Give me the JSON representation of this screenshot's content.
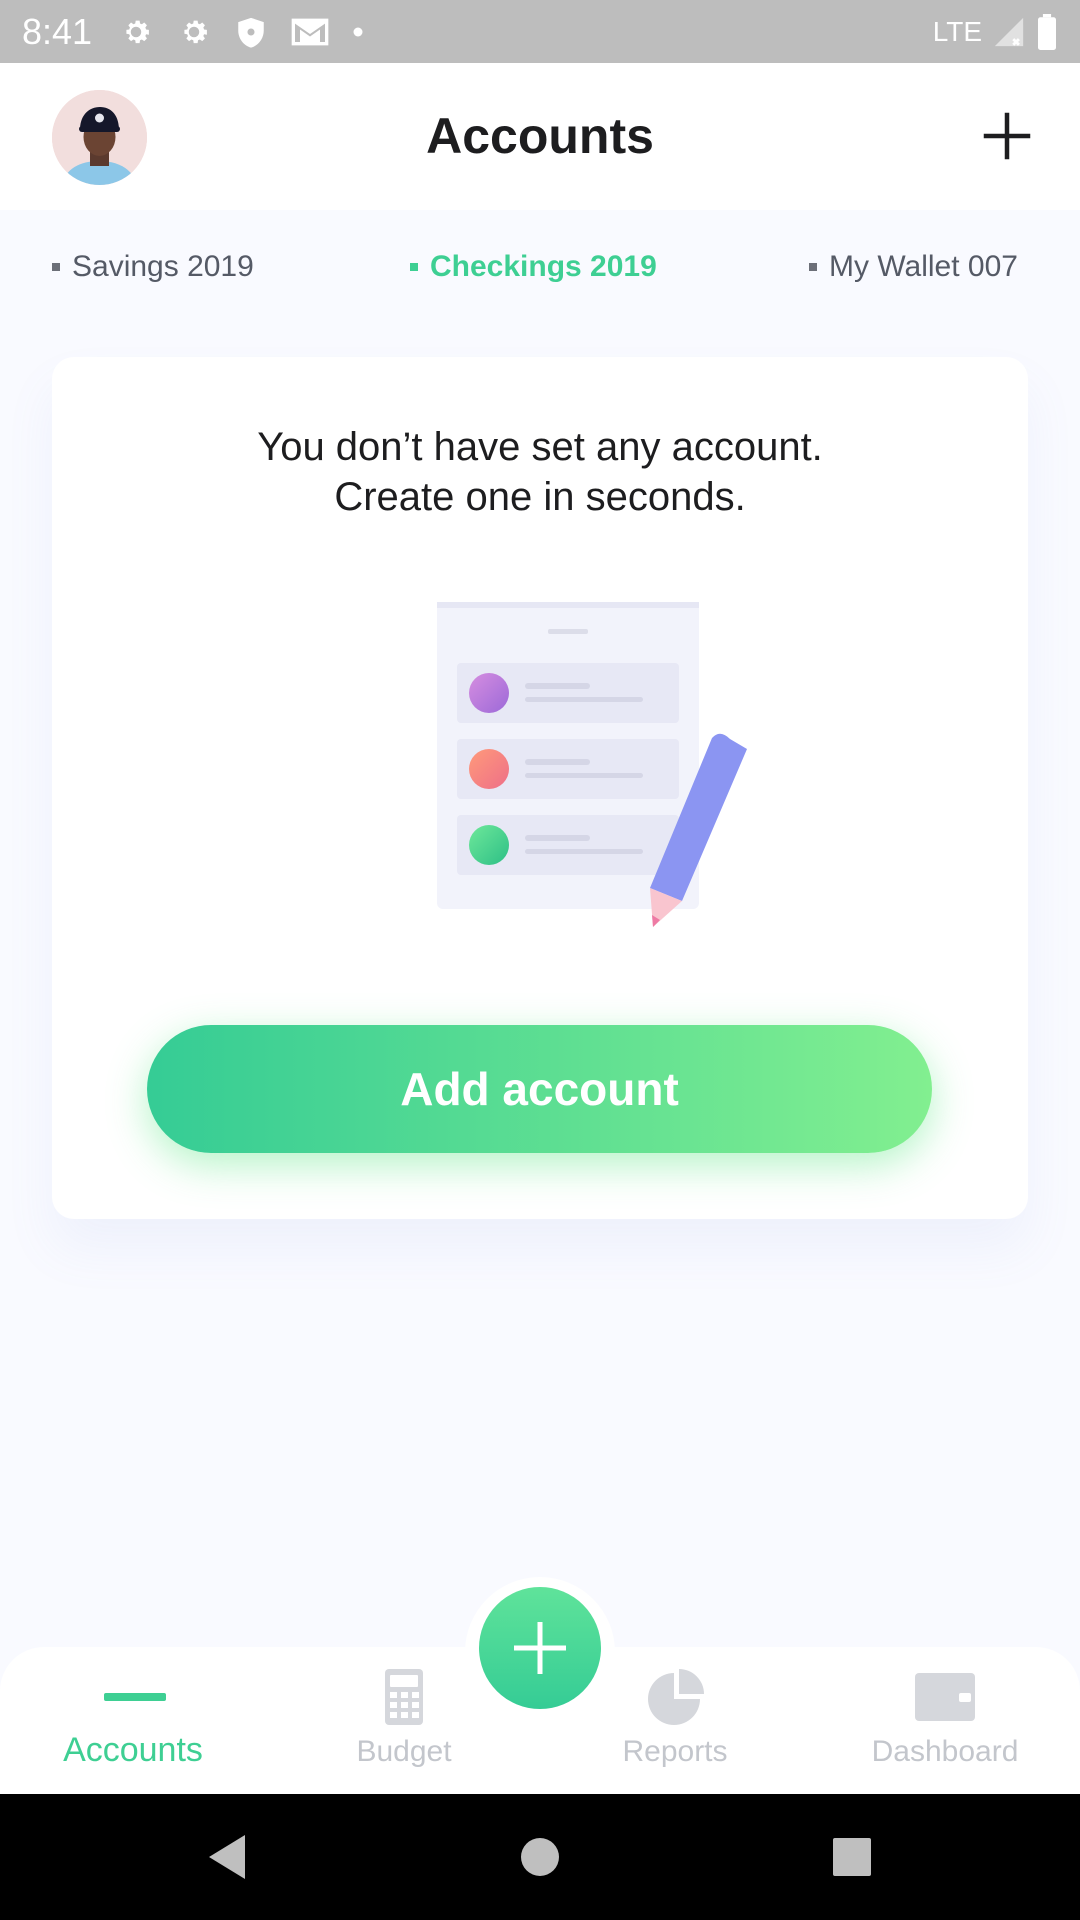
{
  "status_bar": {
    "time": "8:41",
    "network": "LTE",
    "icons": [
      "settings-icon",
      "settings-icon",
      "shield-icon",
      "gmail-icon",
      "dot-icon",
      "signal-icon",
      "battery-icon"
    ]
  },
  "header": {
    "title": "Accounts",
    "avatar": "avatar",
    "add_icon": "plus-icon"
  },
  "tabs": [
    {
      "label": "Savings 2019",
      "active": false
    },
    {
      "label": "Checkings 2019",
      "active": true
    },
    {
      "label": "My Wallet 007",
      "active": false
    }
  ],
  "empty_state": {
    "message_line1": "You don’t have set any account.",
    "message_line2": "Create one in seconds.",
    "button_label": "Add account"
  },
  "bottom_nav": {
    "items": [
      {
        "label": "Accounts",
        "icon": "accounts-indicator",
        "active": true
      },
      {
        "label": "Budget",
        "icon": "calculator-icon",
        "active": false
      },
      {
        "label": "Reports",
        "icon": "pie-chart-icon",
        "active": false
      },
      {
        "label": "Dashboard",
        "icon": "wallet-icon",
        "active": false
      }
    ],
    "fab_icon": "plus-icon"
  },
  "colors": {
    "accent": "#3ecf93",
    "gradient_start": "#35cc95",
    "gradient_end": "#82ef90",
    "inactive": "#c3c6cc",
    "pen": "#8b95f2"
  }
}
